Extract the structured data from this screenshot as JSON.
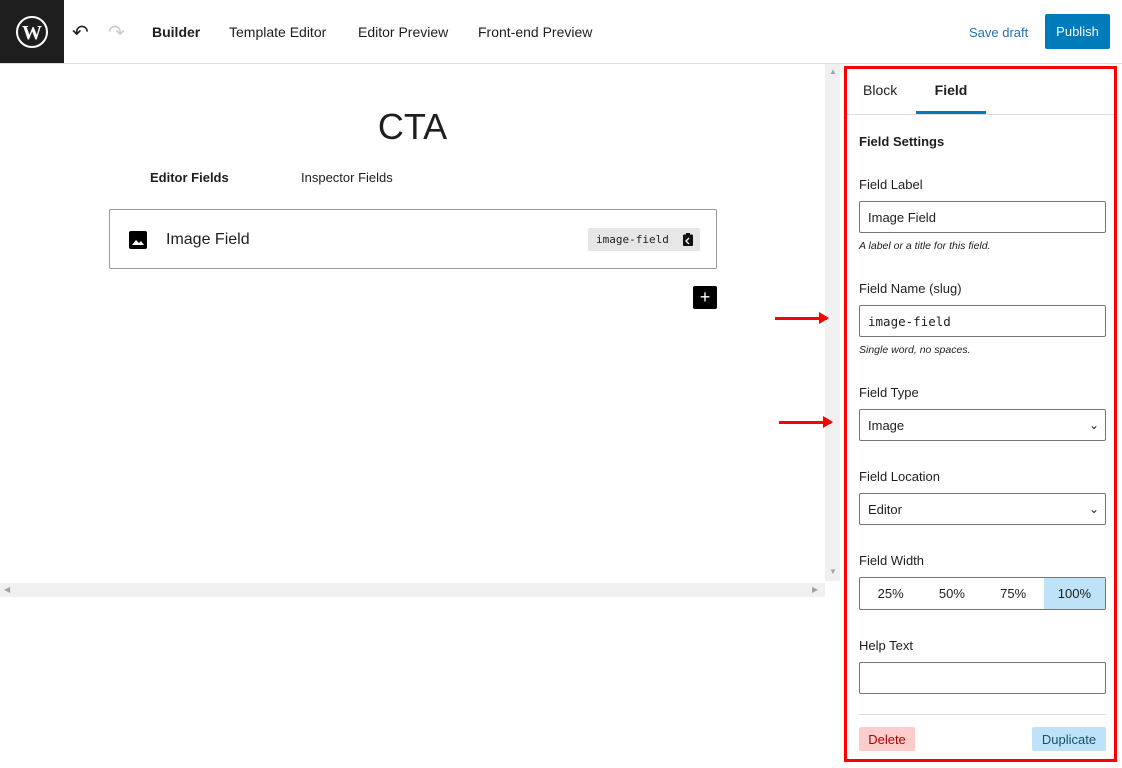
{
  "header": {
    "nav": [
      "Builder",
      "Template Editor",
      "Editor Preview",
      "Front-end Preview"
    ],
    "save_draft": "Save draft",
    "publish": "Publish"
  },
  "canvas": {
    "title": "CTA",
    "tabs": [
      "Editor Fields",
      "Inspector Fields"
    ],
    "field": {
      "label": "Image Field",
      "slug": "image-field"
    },
    "add_label": "+"
  },
  "sidebar": {
    "tabs": [
      "Block",
      "Field"
    ],
    "section_title": "Field Settings",
    "field_label": {
      "label": "Field Label",
      "value": "Image Field",
      "hint": "A label or a title for this field."
    },
    "field_name": {
      "label": "Field Name (slug)",
      "value": "image-field",
      "hint": "Single word, no spaces."
    },
    "field_type": {
      "label": "Field Type",
      "value": "Image"
    },
    "field_location": {
      "label": "Field Location",
      "value": "Editor"
    },
    "field_width": {
      "label": "Field Width",
      "options": [
        "25%",
        "50%",
        "75%",
        "100%"
      ],
      "selected": "100%"
    },
    "help_text": {
      "label": "Help Text",
      "value": ""
    },
    "delete": "Delete",
    "duplicate": "Duplicate"
  },
  "colors": {
    "accent": "#007cba",
    "highlight": "#f00"
  }
}
